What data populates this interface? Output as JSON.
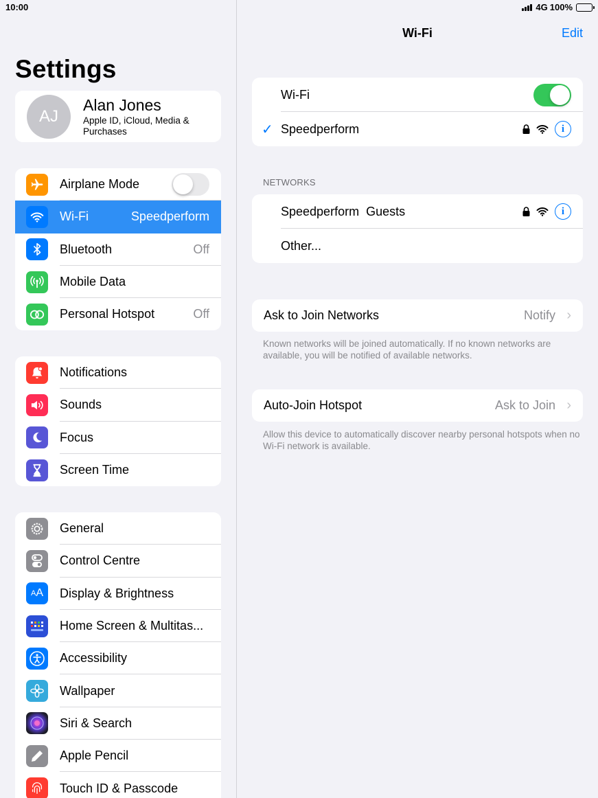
{
  "status_bar": {
    "time": "10:00",
    "network": "4G",
    "battery": "100%"
  },
  "sidebar": {
    "title": "Settings",
    "profile": {
      "initials": "AJ",
      "name": "Alan Jones",
      "subtitle": "Apple ID, iCloud, Media & Purchases"
    },
    "groups": [
      [
        {
          "label": "Airplane Mode",
          "icon": "airplane-icon",
          "color": "#ff9500",
          "toggle": false
        },
        {
          "label": "Wi-Fi",
          "icon": "wifi-icon",
          "color": "#007aff",
          "value": "Speedperform",
          "selected": true
        },
        {
          "label": "Bluetooth",
          "icon": "bluetooth-icon",
          "color": "#007aff",
          "value": "Off"
        },
        {
          "label": "Mobile Data",
          "icon": "antenna-icon",
          "color": "#34c759"
        },
        {
          "label": "Personal Hotspot",
          "icon": "hotspot-icon",
          "color": "#34c759",
          "value": "Off"
        }
      ],
      [
        {
          "label": "Notifications",
          "icon": "bell-icon",
          "color": "#ff3b30"
        },
        {
          "label": "Sounds",
          "icon": "speaker-icon",
          "color": "#ff2d55"
        },
        {
          "label": "Focus",
          "icon": "moon-icon",
          "color": "#5856d6"
        },
        {
          "label": "Screen Time",
          "icon": "hourglass-icon",
          "color": "#5856d6"
        }
      ],
      [
        {
          "label": "General",
          "icon": "gear-icon",
          "color": "#8e8e93"
        },
        {
          "label": "Control Centre",
          "icon": "switches-icon",
          "color": "#8e8e93"
        },
        {
          "label": "Display & Brightness",
          "icon": "text-size-icon",
          "color": "#007aff"
        },
        {
          "label": "Home Screen & Multitas...",
          "icon": "grid-icon",
          "color": "#2c4fd6"
        },
        {
          "label": "Accessibility",
          "icon": "accessibility-icon",
          "color": "#007aff"
        },
        {
          "label": "Wallpaper",
          "icon": "flower-icon",
          "color": "#35aadc"
        },
        {
          "label": "Siri & Search",
          "icon": "siri-icon",
          "color": "#222"
        },
        {
          "label": "Apple Pencil",
          "icon": "pencil-icon",
          "color": "#8e8e93"
        },
        {
          "label": "Touch ID & Passcode",
          "icon": "fingerprint-icon",
          "color": "#ff3b30"
        }
      ]
    ]
  },
  "detail": {
    "title": "Wi-Fi",
    "edit_label": "Edit",
    "wifi_label": "Wi-Fi",
    "wifi_on": true,
    "connected_network": "Speedperform",
    "networks_header": "NETWORKS",
    "networks": [
      "Speedperform  Guests"
    ],
    "other_label": "Other...",
    "ask_to_join": {
      "label": "Ask to Join Networks",
      "value": "Notify",
      "footnote": "Known networks will be joined automatically. If no known networks are available, you will be notified of available networks."
    },
    "auto_join": {
      "label": "Auto-Join Hotspot",
      "value": "Ask to Join",
      "footnote": "Allow this device to automatically discover nearby personal hotspots when no Wi-Fi network is available."
    }
  }
}
